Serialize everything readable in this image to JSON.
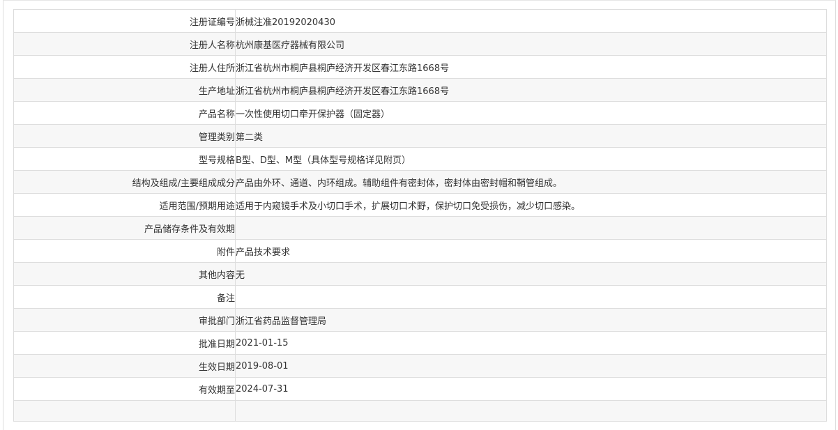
{
  "rows": [
    {
      "label": "注册证编号",
      "value": "浙械注准20192020430"
    },
    {
      "label": "注册人名称",
      "value": "杭州康基医疗器械有限公司"
    },
    {
      "label": "注册人住所",
      "value": "浙江省杭州市桐庐县桐庐经济开发区春江东路1668号"
    },
    {
      "label": "生产地址",
      "value": "浙江省杭州市桐庐县桐庐经济开发区春江东路1668号"
    },
    {
      "label": "产品名称",
      "value": "一次性使用切口牵开保护器（固定器）"
    },
    {
      "label": "管理类别",
      "value": "第二类"
    },
    {
      "label": "型号规格",
      "value": "B型、D型、M型（具体型号规格详见附页）"
    },
    {
      "label": "结构及组成/主要组成成分",
      "value": "产品由外环、通道、内环组成。辅助组件有密封体，密封体由密封帽和鞘管组成。"
    },
    {
      "label": "适用范围/预期用途",
      "value": "适用于内窥镜手术及小切口手术，扩展切口术野，保护切口免受损伤，减少切口感染。"
    },
    {
      "label": "产品储存条件及有效期",
      "value": ""
    },
    {
      "label": "附件",
      "value": "产品技术要求"
    },
    {
      "label": "其他内容",
      "value": "无"
    },
    {
      "label": "备注",
      "value": ""
    },
    {
      "label": "审批部门",
      "value": "浙江省药品监督管理局"
    },
    {
      "label": "批准日期",
      "value": "2021-01-15"
    },
    {
      "label": "生效日期",
      "value": "2019-08-01"
    },
    {
      "label": "有效期至",
      "value": "2024-07-31"
    },
    {
      "label": "",
      "value": ""
    }
  ]
}
